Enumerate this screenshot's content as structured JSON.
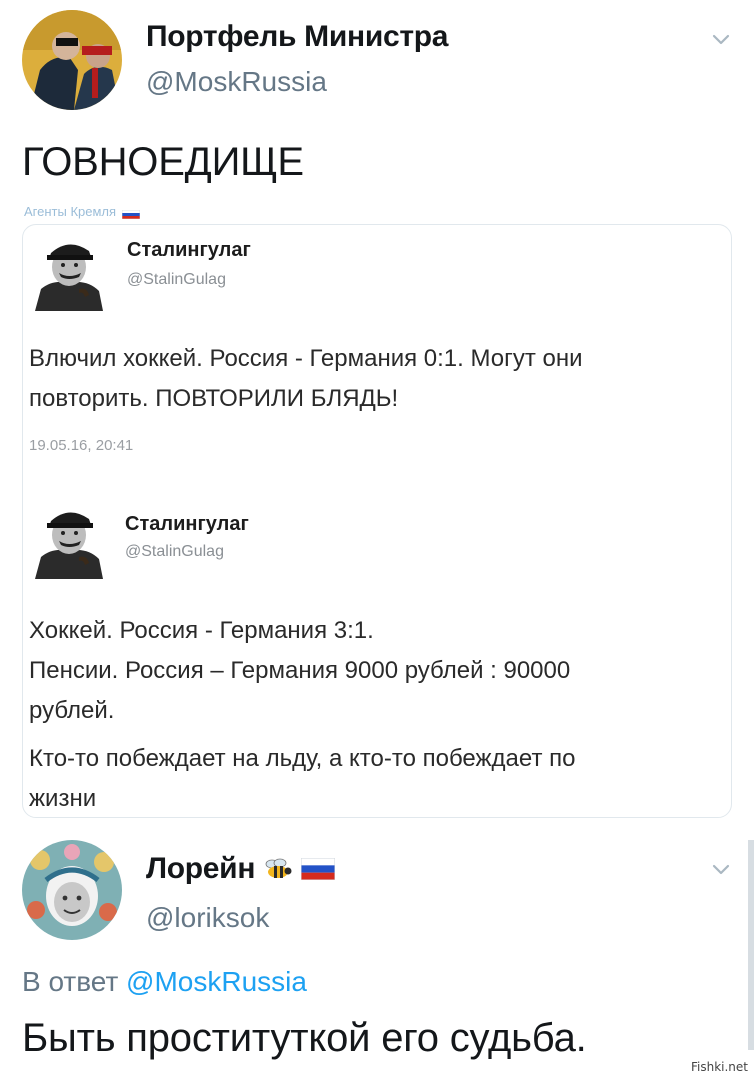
{
  "tweet1": {
    "display_name": "Портфель Министра",
    "handle": "@MoskRussia",
    "text": "ГОВНОЕДИЩЕ",
    "caption": "Агенты Кремля",
    "quote": {
      "post1": {
        "name": "Сталингулаг",
        "handle": "@StalinGulag",
        "line1": "Влючил хоккей. Россия - Германия 0:1. Могут они",
        "line2": "повторить. ПОВТОРИЛИ БЛЯДЬ!",
        "date": "19.05.16, 20:41"
      },
      "post2": {
        "name": "Сталингулаг",
        "handle": "@StalinGulag",
        "line1": "Хоккей. Россия - Германия 3:1.",
        "line2": "Пенсии. Россия – Германия 9000 рублей : 90000",
        "line3": "рублей.",
        "line4": "Кто-то побеждает на льду, а кто-то побеждает по",
        "line5": "жизни"
      }
    }
  },
  "tweet2": {
    "display_name": "Лорейн",
    "handle": "@loriksok",
    "reply_prefix": "В ответ",
    "reply_handle": "@MoskRussia",
    "text": "Быть проституткой его судьба."
  },
  "watermark": "Fishki.net",
  "colors": {
    "handle_gray": "#657786",
    "link_blue": "#1da1f2",
    "border": "#e1e8ed",
    "text": "#14171a"
  },
  "icons": [
    "chevron-down-icon",
    "bee-emoji-icon",
    "russian-flag-icon"
  ]
}
